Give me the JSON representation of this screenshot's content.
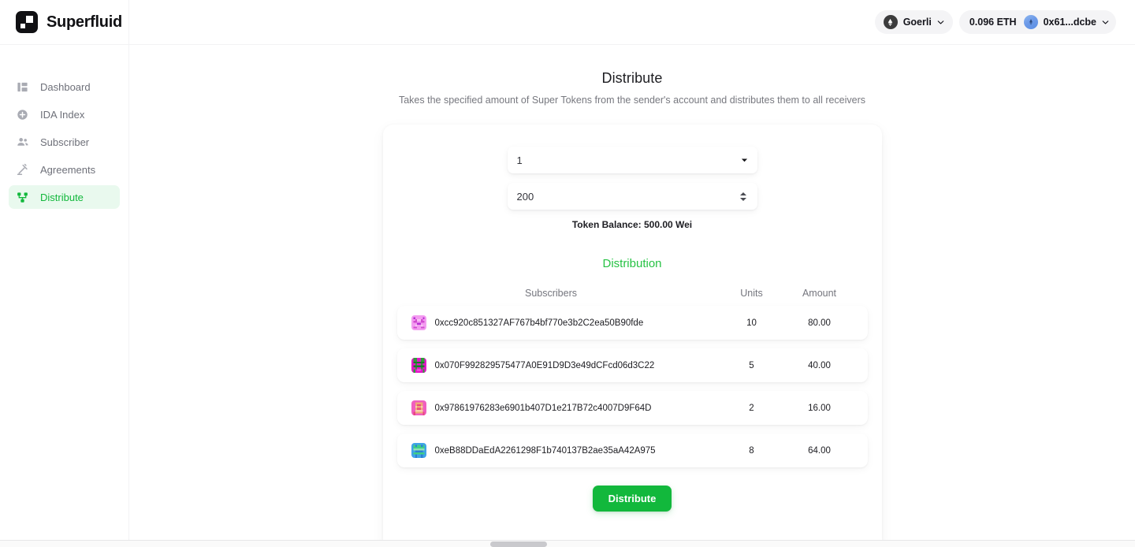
{
  "brand": {
    "name": "Superfluid",
    "logo_icon": "superfluid-logo-icon"
  },
  "topbar": {
    "network": {
      "label": "Goerli",
      "icon": "ethereum-icon",
      "caret_icon": "chevron-down-icon"
    },
    "balance": "0.096 ETH",
    "wallet": {
      "label": "0x61...dcbe",
      "avatar_icon": "wallet-avatar-icon",
      "caret_icon": "chevron-down-icon"
    }
  },
  "sidebar": {
    "items": [
      {
        "label": "Dashboard",
        "icon": "dashboard-grid-icon",
        "active": false
      },
      {
        "label": "IDA Index",
        "icon": "plus-circle-icon",
        "active": false
      },
      {
        "label": "Subscriber",
        "icon": "users-icon",
        "active": false
      },
      {
        "label": "Agreements",
        "icon": "gavel-icon",
        "active": false
      },
      {
        "label": "Distribute",
        "icon": "sitemap-icon",
        "active": true
      }
    ]
  },
  "page": {
    "title": "Distribute",
    "subtitle": "Takes the specified amount of Super Tokens from the sender's account and distributes them to all receivers"
  },
  "form": {
    "index_select": {
      "value": "1",
      "placeholder": "Index",
      "caret_icon": "chevron-down-icon"
    },
    "amount_input": {
      "value": "200",
      "placeholder": "Amount",
      "stepper_icon": "number-stepper-icon"
    },
    "token_balance_label": "Token Balance: 500.00 Wei"
  },
  "distribution": {
    "heading": "Distribution",
    "columns": [
      "Subscribers",
      "Units",
      "Amount"
    ],
    "rows": [
      {
        "address": "0xcc920c851327AF767b4bf770e3b2C2ea50B90fde",
        "units": "10",
        "amount": "80.00",
        "avatar_icon": "identicon-avatar",
        "avatar_colors": [
          "#f39cf0",
          "#d24bd0",
          "#f6c7f4",
          "#b92fd6"
        ]
      },
      {
        "address": "0x070F992829575477A0E91D9D3e49dCFcd06d3C22",
        "units": "5",
        "amount": "40.00",
        "avatar_icon": "identicon-avatar",
        "avatar_colors": [
          "#e318c8",
          "#2f9e3a",
          "#f45ae0",
          "#1d7a2a"
        ]
      },
      {
        "address": "0x97861976283e6901b407D1e217B72c4007D9F64D",
        "units": "2",
        "amount": "16.00",
        "avatar_icon": "identicon-avatar",
        "avatar_colors": [
          "#f05fbf",
          "#f0a878",
          "#e8477f",
          "#f7cfa8"
        ]
      },
      {
        "address": "0xeB88DDaEdA2261298F1b740137B2ae35aA42A975",
        "units": "8",
        "amount": "64.00",
        "avatar_icon": "identicon-avatar",
        "avatar_colors": [
          "#3fa3e8",
          "#3fcf86",
          "#2b7fd4",
          "#8fe0b5"
        ]
      }
    ]
  },
  "actions": {
    "submit_label": "Distribute"
  },
  "colors": {
    "accent_green": "#12b83c",
    "heading_green": "#27c244",
    "active_nav_bg": "#e9f9ee",
    "text_primary": "#1c1c21",
    "text_muted": "#74757d",
    "chip_bg": "#f4f4f6"
  }
}
